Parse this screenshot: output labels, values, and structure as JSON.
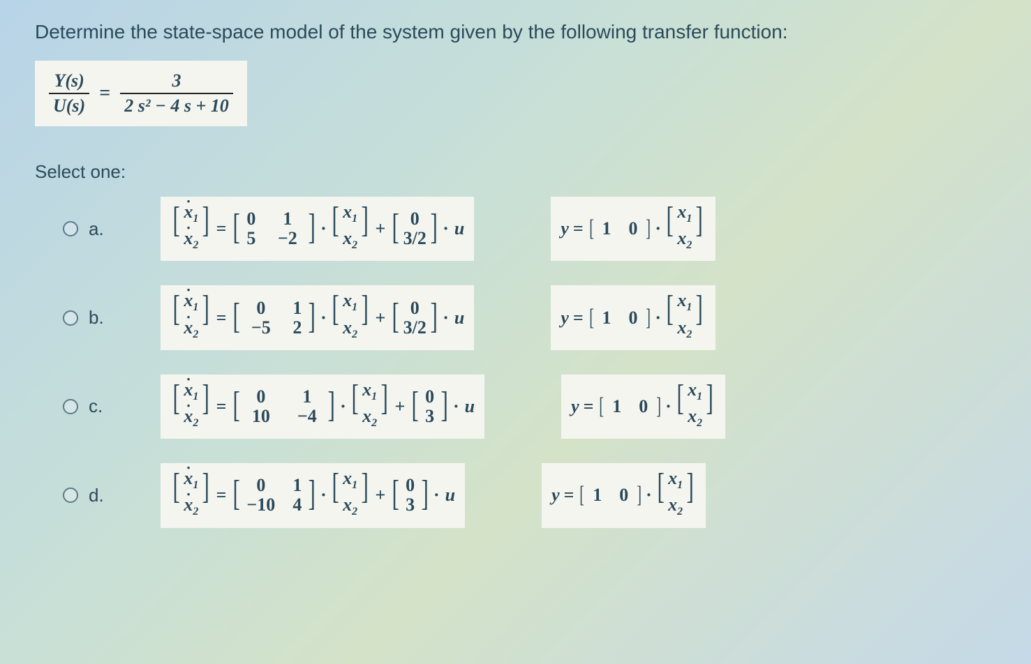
{
  "question": "Determine the state-space model of the system given by the following transfer function:",
  "transfer_function": {
    "lhs_num": "Y(s)",
    "lhs_den": "U(s)",
    "rhs_num": "3",
    "rhs_den": "2 s² − 4 s + 10"
  },
  "select_text": "Select one:",
  "options": [
    {
      "label": "a.",
      "A": [
        [
          "0",
          "1"
        ],
        [
          "5",
          "−2"
        ]
      ],
      "B": [
        "0",
        "3/2"
      ],
      "C": [
        "1",
        "0"
      ]
    },
    {
      "label": "b.",
      "A": [
        [
          "0",
          "1"
        ],
        [
          "−5",
          "2"
        ]
      ],
      "B": [
        "0",
        "3/2"
      ],
      "C": [
        "1",
        "0"
      ]
    },
    {
      "label": "c.",
      "A": [
        [
          "0",
          "1"
        ],
        [
          "10",
          "−4"
        ]
      ],
      "B": [
        "0",
        "3"
      ],
      "C": [
        "1",
        "0"
      ]
    },
    {
      "label": "d.",
      "A": [
        [
          "0",
          "1"
        ],
        [
          "−10",
          "4"
        ]
      ],
      "B": [
        "0",
        "3"
      ],
      "C": [
        "1",
        "0"
      ]
    }
  ]
}
